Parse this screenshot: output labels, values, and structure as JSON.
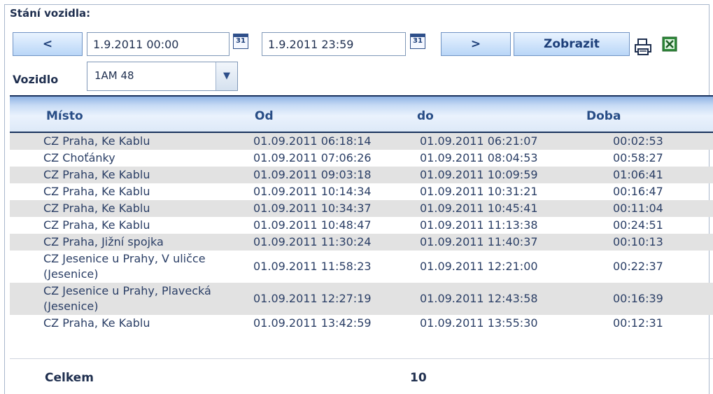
{
  "panel": {
    "title": "Stání vozidla:"
  },
  "toolbar": {
    "prev_label": "<",
    "from_date": "1.9.2011 00:00",
    "to_date": "1.9.2011 23:59",
    "calendar_day": "31",
    "next_label": ">",
    "show_label": "Zobrazit",
    "print_icon": "printer-icon",
    "excel_icon": "excel-icon"
  },
  "vehicle": {
    "label": "Vozidlo",
    "value": "1AM 48"
  },
  "table": {
    "columns": [
      "Místo",
      "Od",
      "do",
      "Doba"
    ],
    "rows": [
      {
        "place": "CZ Praha, Ke Kablu",
        "from": "01.09.2011 06:18:14",
        "to": "01.09.2011 06:21:07",
        "duration": "00:02:53"
      },
      {
        "place": "CZ Choťánky",
        "from": "01.09.2011 07:06:26",
        "to": "01.09.2011 08:04:53",
        "duration": "00:58:27"
      },
      {
        "place": "CZ Praha, Ke Kablu",
        "from": "01.09.2011 09:03:18",
        "to": "01.09.2011 10:09:59",
        "duration": "01:06:41"
      },
      {
        "place": "CZ Praha, Ke Kablu",
        "from": "01.09.2011 10:14:34",
        "to": "01.09.2011 10:31:21",
        "duration": "00:16:47"
      },
      {
        "place": "CZ Praha, Ke Kablu",
        "from": "01.09.2011 10:34:37",
        "to": "01.09.2011 10:45:41",
        "duration": "00:11:04"
      },
      {
        "place": "CZ Praha, Ke Kablu",
        "from": "01.09.2011 10:48:47",
        "to": "01.09.2011 11:13:38",
        "duration": "00:24:51"
      },
      {
        "place": "CZ Praha, Jižní spojka",
        "from": "01.09.2011 11:30:24",
        "to": "01.09.2011 11:40:37",
        "duration": "00:10:13"
      },
      {
        "place": "CZ Jesenice u Prahy, V uličce",
        "place2": "(Jesenice)",
        "from": "01.09.2011 11:58:23",
        "to": "01.09.2011 12:21:00",
        "duration": "00:22:37"
      },
      {
        "place": "CZ Jesenice u Prahy, Plavecká",
        "place2": "(Jesenice)",
        "from": "01.09.2011 12:27:19",
        "to": "01.09.2011 12:43:58",
        "duration": "00:16:39"
      },
      {
        "place": "CZ Praha, Ke Kablu",
        "from": "01.09.2011 13:42:59",
        "to": "01.09.2011 13:55:30",
        "duration": "00:12:31"
      }
    ],
    "total_label": "Celkem",
    "total_value": "10"
  }
}
